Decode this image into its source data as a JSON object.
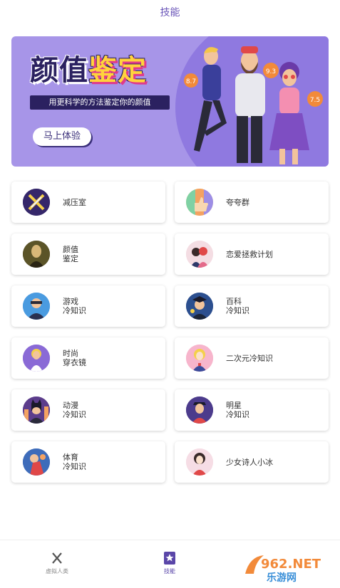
{
  "header": {
    "title": "技能"
  },
  "banner": {
    "title_part1": "颜值",
    "title_part2": "鉴定",
    "subtitle": "用更科学的方法鉴定你的颜值",
    "cta_label": "马上体验",
    "scores": [
      "8.7",
      "9.3",
      "7.5"
    ]
  },
  "skills": [
    {
      "line1": "减压室",
      "line2": ""
    },
    {
      "line1": "夸夸群",
      "line2": ""
    },
    {
      "line1": "颜值",
      "line2": "鉴定"
    },
    {
      "line1": "恋爱拯救计划",
      "line2": ""
    },
    {
      "line1": "游戏",
      "line2": "冷知识"
    },
    {
      "line1": "百科",
      "line2": "冷知识"
    },
    {
      "line1": "时尚",
      "line2": "穿衣镜"
    },
    {
      "line1": "二次元冷知识",
      "line2": ""
    },
    {
      "line1": "动漫",
      "line2": "冷知识"
    },
    {
      "line1": "明星",
      "line2": "冷知识"
    },
    {
      "line1": "体育",
      "line2": "冷知识"
    },
    {
      "line1": "少女诗人小冰",
      "line2": ""
    }
  ],
  "tabbar": {
    "tab1_label": "虚拟人类",
    "tab2_label": "技能"
  },
  "watermark": {
    "top": "962.NET",
    "bottom": "乐游网"
  },
  "colors": {
    "accent": "#6a55b8",
    "banner_bg": "#a795e8",
    "banner_dark": "#2b2160"
  }
}
